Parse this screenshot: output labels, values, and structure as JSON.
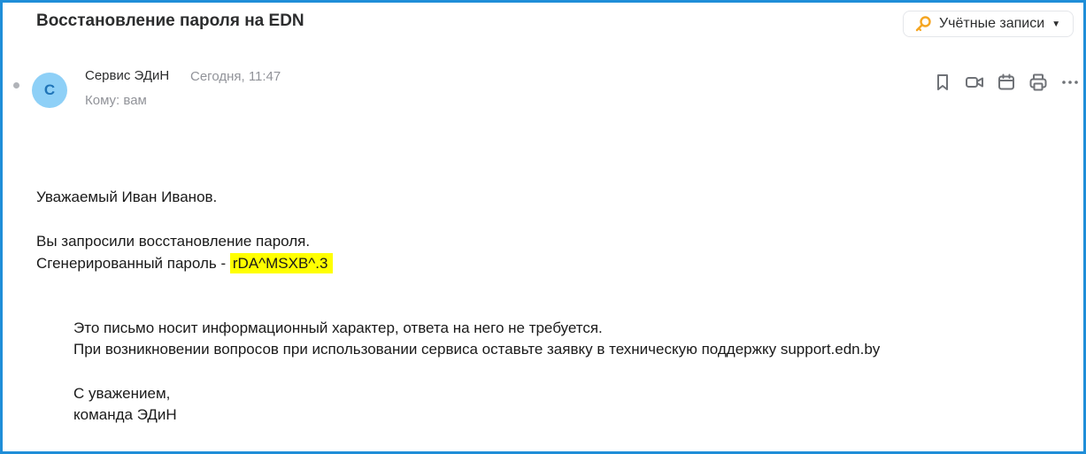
{
  "email": {
    "subject": "Восстановление пароля на EDN",
    "sender": {
      "name": "Сервис ЭДиН",
      "avatar_letter": "С",
      "avatar_color": "#8ed0f7"
    },
    "date": "Сегодня, 11:47",
    "to": "Кому: вам",
    "body": {
      "greeting": "Уважаемый Иван Иванов.",
      "line1": "Вы запросили восстановление пароля.",
      "line2_prefix": "Сгенерированный пароль -",
      "password": "rDA^MSXB^.3",
      "note1": "Это письмо носит информационный характер, ответа на него не требуется.",
      "note2": "При возникновении вопросов при использовании сервиса оставьте заявку в техническую поддержку support.edn.by",
      "regards": "С уважением,",
      "team": "команда ЭДиН"
    }
  },
  "header": {
    "accounts_label": "Учётные записи"
  },
  "toolbar": {
    "icons": [
      "bookmark-icon",
      "video-icon",
      "calendar-icon",
      "print-icon",
      "more-icon"
    ]
  },
  "colors": {
    "frame_border": "#1f8ed8",
    "highlight": "#ffff00",
    "accent_key": "#f5a623"
  }
}
